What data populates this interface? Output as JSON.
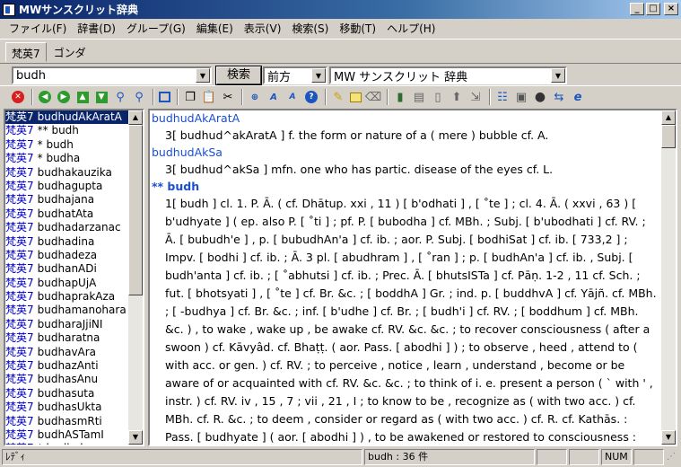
{
  "window": {
    "title": "MWサンスクリット辞典"
  },
  "menu": [
    "ファイル(F)",
    "辞書(D)",
    "グループ(G)",
    "編集(E)",
    "表示(V)",
    "検索(S)",
    "移動(T)",
    "ヘルプ(H)"
  ],
  "tabs": [
    {
      "label": "梵英7",
      "active": true
    },
    {
      "label": "ゴンダ",
      "active": false
    }
  ],
  "search": {
    "query": "budh",
    "button_label": "検索",
    "mode": "前方",
    "dictionary": "MW サンスクリット 辞典"
  },
  "word_list": [
    {
      "src": "梵英7",
      "word": "budhudAkAratA",
      "selected": true
    },
    {
      "src": "梵英7",
      "word": "** budh"
    },
    {
      "src": "梵英7",
      "word": "* budh"
    },
    {
      "src": "梵英7",
      "word": "* budha"
    },
    {
      "src": "梵英7",
      "word": "budhakauzika"
    },
    {
      "src": "梵英7",
      "word": "budhagupta"
    },
    {
      "src": "梵英7",
      "word": "budhajana"
    },
    {
      "src": "梵英7",
      "word": "budhatAta"
    },
    {
      "src": "梵英7",
      "word": "budhadarzanac"
    },
    {
      "src": "梵英7",
      "word": "budhadina"
    },
    {
      "src": "梵英7",
      "word": "budhadeza"
    },
    {
      "src": "梵英7",
      "word": "budhanADi"
    },
    {
      "src": "梵英7",
      "word": "budhapUjA"
    },
    {
      "src": "梵英7",
      "word": "budhaprakAza"
    },
    {
      "src": "梵英7",
      "word": "budhamanohara"
    },
    {
      "src": "梵英7",
      "word": "budharaJjiNI"
    },
    {
      "src": "梵英7",
      "word": "budharatna"
    },
    {
      "src": "梵英7",
      "word": "budhavAra"
    },
    {
      "src": "梵英7",
      "word": "budhazAnti"
    },
    {
      "src": "梵英7",
      "word": "budhasAnu"
    },
    {
      "src": "梵英7",
      "word": "budhasuta"
    },
    {
      "src": "梵英7",
      "word": "budhasUkta"
    },
    {
      "src": "梵英7",
      "word": "budhasmRti"
    },
    {
      "src": "梵英7",
      "word": "budhASTamI"
    },
    {
      "src": "梵英7",
      "word": "* budhaka"
    }
  ],
  "entries": [
    {
      "headword": "budhudAkAratA",
      "main": false,
      "definition": "3[ budhud^akAratA ] f. the form or nature of a ( mere ) bubble cf. A."
    },
    {
      "headword": "budhudAkSa",
      "main": false,
      "definition": "3[ budhud^akSa ] mfn. one who has partic. disease of the eyes cf. L."
    },
    {
      "headword": "** budh",
      "main": true,
      "definition": "1[ budh ] cl. 1. P. Ā. ( cf. Dhātup. xxi , 11 ) [ b'odhati ] , [ ˚te ] ; cl. 4. Ā. ( xxvi , 63 ) [ b'udhyate ] ( ep. also P. [ ˚ti ] ; pf. P. [ bubodha ] cf. MBh. ; Subj. [ b'ubodhati ] cf. RV. ; Ā. [ bubudh'e ] , p. [ bubudhAn'a ] cf. ib. ; aor. P. Subj. [ bodhiSat ] cf. ib. [ 733,2 ] ; Impv. [ bodhi ] cf. ib. ; Ā. 3 pl. [ abudhram ] , [ ˚ran ] ; p. [ budhAn'a ] cf. ib. , Subj. [ budh'anta ] cf. ib. ; [ ˚abhutsi ] cf. ib. ; Prec. Ā. [ bhutsISTa ] cf. Pāṇ. 1-2 , 11 cf. Sch. ; fut. [ bhotsyati ] , [ ˚te ] cf. Br. &c. ; [ boddhA ] Gr. ; ind. p. [ buddhvA ] cf. Yājñ. cf. MBh. ; [ -budhya ] cf. Br. &c. ; inf. [ b'udhe ] cf. Br. ; [ budh'i ] cf. RV. ; [ boddhum ] cf. MBh. &c. ) , to wake , wake up , be awake cf. RV. &c. &c. ; to recover consciousness ( after a swoon ) cf. Kāvyâd. cf. Bhaṭṭ. ( aor. Pass. [ abodhi ] ) ; to observe , heed , attend to ( with acc. or gen. ) cf. RV. ; to perceive , notice , learn , understand , become or be aware of or acquainted with cf. RV. &c. &c. ; to think of i. e. present a person ( ` with ' , instr. ) cf. RV. iv , 15 , 7 ; vii , 21 , I ; to know to be , recognize as ( with two acc. ) cf. MBh. cf. R. &c. ; to deem , consider or regard as ( with two acc. ) cf. R. cf. Kathās. : Pass. [ budhyate ] ( aor. [ abodhi ] ) , to be awakened or restored to consciousness : See above : Ca"
    }
  ],
  "status": {
    "left": "ﾚﾃﾞｨ",
    "center": "budh : 36 件",
    "num": "NUM"
  }
}
